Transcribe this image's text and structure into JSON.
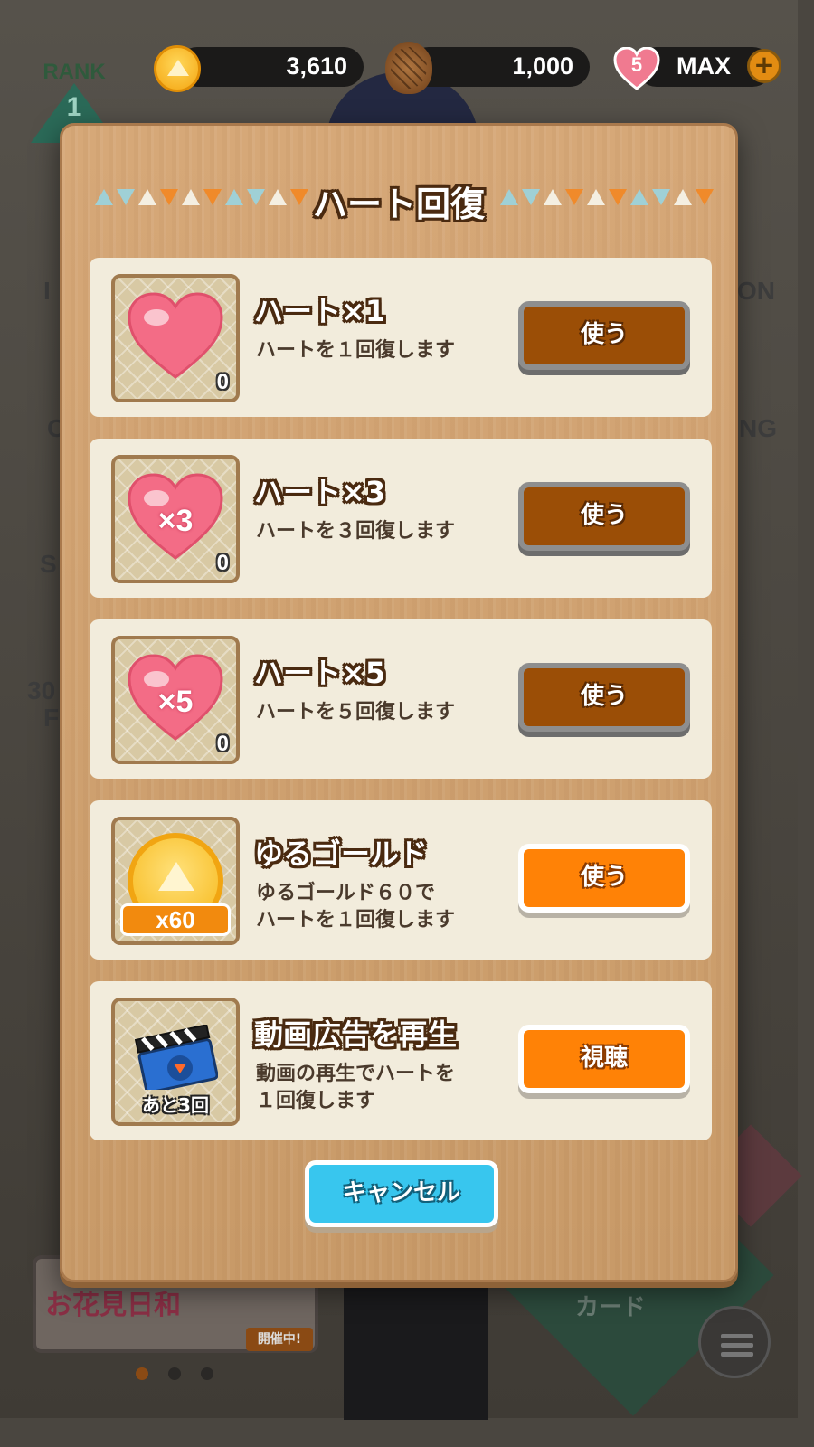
{
  "hud": {
    "rank_label": "RANK",
    "rank_value": "1",
    "gold": "3,610",
    "pinecones": "1,000",
    "hearts_count": "5",
    "hearts_status": "MAX",
    "plus": "+"
  },
  "background": {
    "banner_text": "お花見日和",
    "banner_badge": "開催中!",
    "card_label": "カード",
    "side_fragments": [
      "I",
      "ON",
      "C",
      "NG",
      "S",
      "30",
      "F"
    ]
  },
  "dialog": {
    "title": "ハート回復",
    "cancel_label": "キャンセル",
    "items": [
      {
        "name": "ハート×1",
        "desc": "ハートを１回復します",
        "count": "0",
        "button": "使う",
        "multiplier": "",
        "state": "disabled"
      },
      {
        "name": "ハート×3",
        "desc": "ハートを３回復します",
        "count": "0",
        "button": "使う",
        "multiplier": "×3",
        "state": "disabled"
      },
      {
        "name": "ハート×5",
        "desc": "ハートを５回復します",
        "count": "0",
        "button": "使う",
        "multiplier": "×5",
        "state": "disabled"
      },
      {
        "name": "ゆるゴールド",
        "desc": "ゆるゴールド６０で\nハートを１回復します",
        "quantity": "x60",
        "button": "使う",
        "state": "active"
      },
      {
        "name": "動画広告を再生",
        "desc": "動画の再生でハートを\n１回復します",
        "remaining": "あと3回",
        "button": "視聴",
        "state": "active"
      }
    ]
  },
  "colors": {
    "button_active": "#ff8206",
    "button_disabled": "#9b4e06",
    "cancel": "#38c6ee",
    "panel": "#f2ecdc",
    "dialog_wood": "#d6a878"
  },
  "icons": [
    "gold-coin-icon",
    "pinecone-icon",
    "heart-icon",
    "plus-icon",
    "clapperboard-icon",
    "menu-icon"
  ]
}
